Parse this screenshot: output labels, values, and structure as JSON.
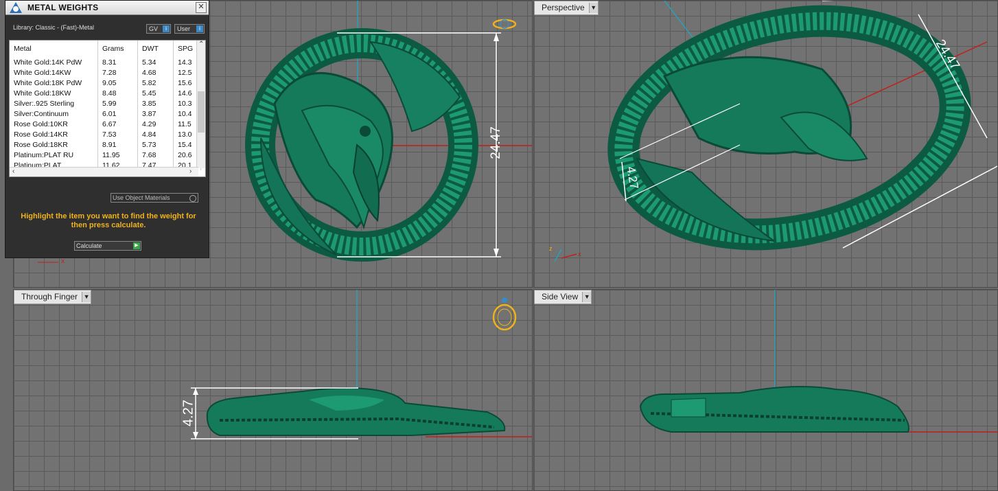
{
  "panel": {
    "title": "METAL WEIGHTS",
    "close_label": "✕",
    "library_label": "Library: Classic - (Fast)-Metal",
    "gv_label": "GV",
    "user_label": "User",
    "columns": [
      "Metal",
      "Grams",
      "DWT",
      "SPG"
    ],
    "rows": [
      [
        "White Gold:14K PdW",
        "8.31",
        "5.34",
        "14.3"
      ],
      [
        "White Gold:14KW",
        "7.28",
        "4.68",
        "12.5"
      ],
      [
        "White Gold:18K PdW",
        "9.05",
        "5.82",
        "15.6"
      ],
      [
        "White Gold:18KW",
        "8.48",
        "5.45",
        "14.6"
      ],
      [
        "Silver:.925 Sterling",
        "5.99",
        "3.85",
        "10.3"
      ],
      [
        "Silver:Continuum",
        "6.01",
        "3.87",
        "10.4"
      ],
      [
        "Rose Gold:10KR",
        "6.67",
        "4.29",
        "11.5"
      ],
      [
        "Rose Gold:14KR",
        "7.53",
        "4.84",
        "13.0"
      ],
      [
        "Rose Gold:18KR",
        "8.91",
        "5.73",
        "15.4"
      ],
      [
        "Platinum:PLAT RU",
        "11.95",
        "7.68",
        "20.6"
      ],
      [
        "Platinum:PLAT",
        "11.62",
        "7.47",
        "20.1"
      ]
    ],
    "use_object_materials": "Use Object Materials",
    "hint": "Highlight the item you want to find the weight for then press calculate.",
    "calculate_label": "Calculate"
  },
  "viewports": {
    "top": {
      "dimension": "24.47"
    },
    "perspective": {
      "label": "Perspective",
      "dimension_a": "24.47",
      "dimension_b": "4.27"
    },
    "through_finger": {
      "label": "Through Finger",
      "dimension": "4.27"
    },
    "side": {
      "label": "Side View"
    }
  },
  "colors": {
    "model": "#17805f",
    "model_dark": "#0b4a37",
    "accent": "#f0b21c",
    "axis_red": "#c0201a",
    "axis_cyan": "#2aa0b8"
  }
}
